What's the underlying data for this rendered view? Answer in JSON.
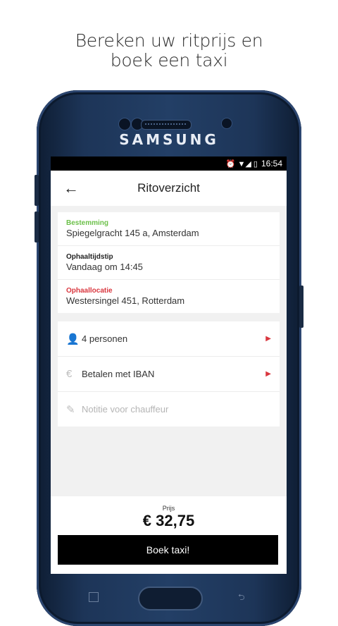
{
  "promo": {
    "line1": "Bereken uw ritprijs en",
    "line2": "boek een taxi"
  },
  "device": {
    "brand": "SAMSUNG"
  },
  "statusbar": {
    "icons": "⏰ ▼◢ ▯",
    "time": "16:54"
  },
  "appbar": {
    "back_icon": "←",
    "title": "Ritoverzicht"
  },
  "addresses": [
    {
      "label": "Bestemming",
      "value": "Spiegelgracht 145 a, Amsterdam",
      "color": "#6cc04a"
    },
    {
      "label": "Ophaaltijdstip",
      "value": "Vandaag om 14:45",
      "color": "#222222"
    },
    {
      "label": "Ophaallocatie",
      "value": "Westersingel 451, Rotterdam",
      "color": "#d9363e"
    }
  ],
  "options": {
    "persons": {
      "icon": "person-icon",
      "glyph": "👤",
      "label": "4 personen",
      "arrow": "▶"
    },
    "payment": {
      "icon": "euro-icon",
      "glyph": "€",
      "label": "Betalen met IBAN",
      "arrow": "▶"
    },
    "note": {
      "icon": "pencil-icon",
      "glyph": "✎",
      "placeholder": "Notitie voor chauffeur"
    }
  },
  "footer": {
    "price_label": "Prijs",
    "price": "€ 32,75",
    "book_button": "Boek taxi!"
  },
  "colors": {
    "accent_red": "#d9363e",
    "accent_green": "#6cc04a",
    "phone_body": "#1d3558"
  }
}
